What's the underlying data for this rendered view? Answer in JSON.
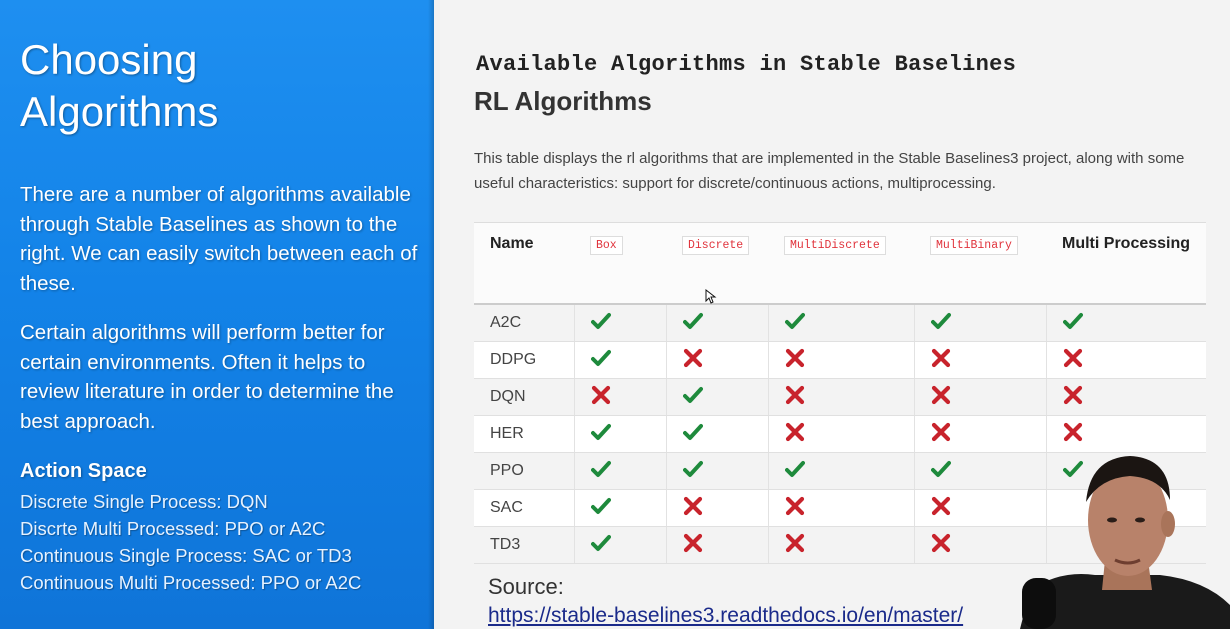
{
  "slide": {
    "title": "Choosing\nAlgorithms",
    "paragraph1": "There are a number of algorithms available through Stable Baselines as shown to the right. We can easily switch between each of these.",
    "paragraph2": "Certain algorithms will perform better for certain environments. Often it helps to review literature in order to determine the best approach.",
    "action_space_heading": "Action Space",
    "action_space_items": [
      "Discrete Single Process: DQN",
      "Discrte Multi Processed: PPO or A2C",
      "Continuous Single Process: SAC or TD3",
      "Continuous Multi Processed: PPO or A2C"
    ]
  },
  "doc": {
    "mono_title": "Available Algorithms in Stable Baselines",
    "heading": "RL Algorithms",
    "description": "This table displays the rl algorithms that are implemented in the Stable Baselines3 project, along with some useful characteristics: support for discrete/continuous actions, multiprocessing.",
    "columns": [
      "Name",
      "Box",
      "Discrete",
      "MultiDiscrete",
      "MultiBinary",
      "Multi Processing"
    ],
    "rows": [
      {
        "name": "A2C",
        "marks": [
          true,
          true,
          true,
          true,
          true
        ]
      },
      {
        "name": "DDPG",
        "marks": [
          true,
          false,
          false,
          false,
          false
        ]
      },
      {
        "name": "DQN",
        "marks": [
          false,
          true,
          false,
          false,
          false
        ]
      },
      {
        "name": "HER",
        "marks": [
          true,
          true,
          false,
          false,
          false
        ]
      },
      {
        "name": "PPO",
        "marks": [
          true,
          true,
          true,
          true,
          true
        ]
      },
      {
        "name": "SAC",
        "marks": [
          true,
          false,
          false,
          false,
          null
        ]
      },
      {
        "name": "TD3",
        "marks": [
          true,
          false,
          false,
          false,
          null
        ]
      }
    ],
    "source_label": "Source:",
    "source_link": "https://stable-baselines3.readthedocs.io/en/master/"
  },
  "colors": {
    "check": "#1e8a3c",
    "cross": "#c8232c",
    "panel_blue": "#1383e8"
  }
}
